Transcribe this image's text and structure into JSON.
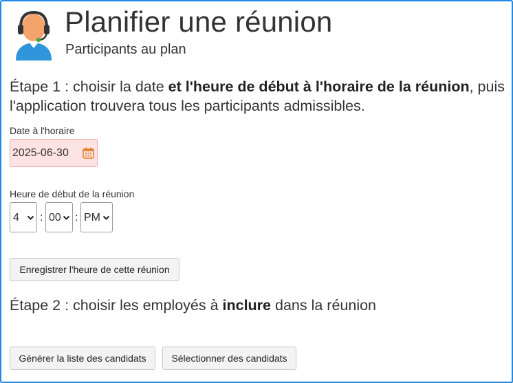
{
  "header": {
    "title": "Planifier une réunion",
    "subtitle": "Participants au plan",
    "icon": "support-agent-icon"
  },
  "step1": {
    "prefix": "Étape 1 : choisir la date ",
    "bold": "et l'heure de début à l'horaire de la réunion",
    "suffix": ", puis l'application trouvera tous les participants admissibles."
  },
  "date_field": {
    "label": "Date à l'horaire",
    "value": "2025-06-30",
    "icon": "calendar-icon"
  },
  "time_field": {
    "label": "Heure de début de la réunion",
    "hour": "4",
    "minute": "00",
    "ampm": "PM",
    "separator": ":"
  },
  "buttons": {
    "save_time": "Enregistrer l'heure de cette réunion",
    "generate_list": "Générer la liste des candidats",
    "select_candidates": "Sélectionner des candidats"
  },
  "step2": {
    "prefix": "Étape 2 : choisir les employés à ",
    "bold": "inclure",
    "suffix": " dans la réunion"
  },
  "colors": {
    "frame_border": "#1e88e5",
    "date_bg": "#fde3e3",
    "date_border": "#f0a8a8",
    "calendar_icon": "#e8812f",
    "avatar_skin": "#f4a46a",
    "avatar_shirt": "#2f96dc",
    "headset": "#333333"
  }
}
